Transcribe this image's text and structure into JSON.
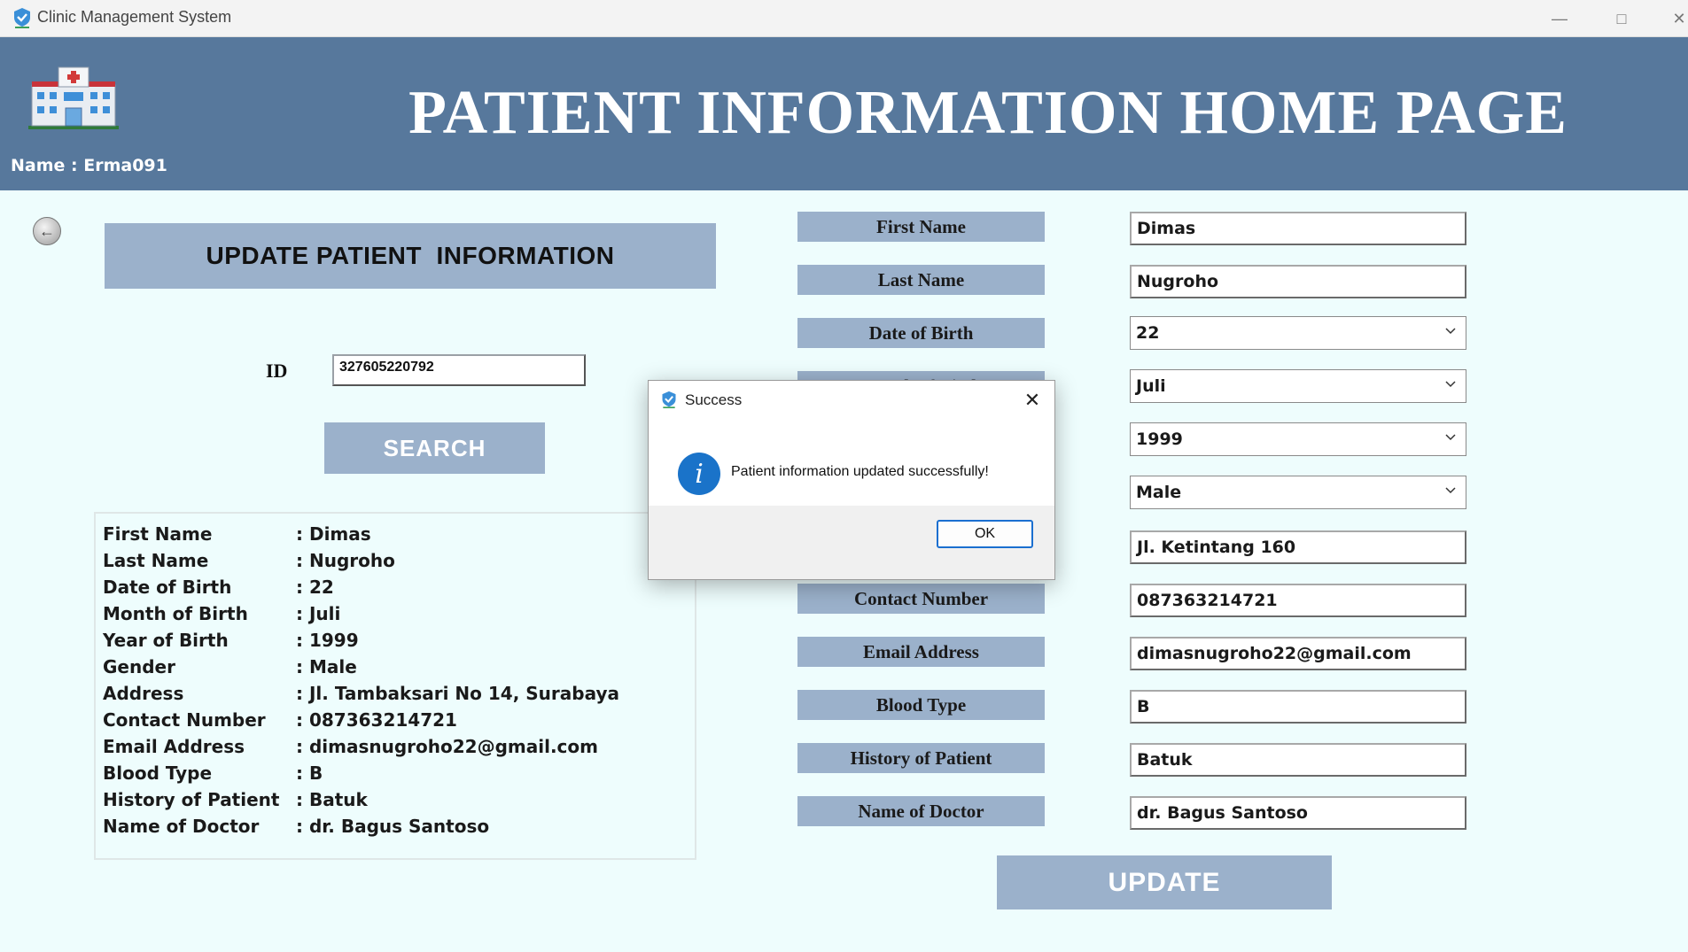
{
  "window": {
    "title": "Clinic Management System"
  },
  "header": {
    "heading": "PATIENT INFORMATION HOME PAGE",
    "user": "Name :  Erma091"
  },
  "left_panel": {
    "banner": "UPDATE PATIENT  INFORMATION",
    "id_label": "ID",
    "id_value": "327605220792",
    "search_label": "SEARCH",
    "info": [
      {
        "key": "First Name",
        "value": ": Dimas"
      },
      {
        "key": "Last Name",
        "value": ": Nugroho"
      },
      {
        "key": "Date of Birth",
        "value": ": 22"
      },
      {
        "key": "Month of Birth",
        "value": ": Juli"
      },
      {
        "key": "Year of Birth",
        "value": ": 1999"
      },
      {
        "key": "Gender",
        "value": ": Male"
      },
      {
        "key": "Address",
        "value": ": Jl. Tambaksari No 14, Surabaya"
      },
      {
        "key": "Contact Number",
        "value": ": 087363214721"
      },
      {
        "key": "Email Address",
        "value": ": dimasnugroho22@gmail.com"
      },
      {
        "key": "Blood Type",
        "value": ": B"
      },
      {
        "key": "History of Patient",
        "value": ": Batuk"
      },
      {
        "key": "Name of Doctor",
        "value": ": dr. Bagus Santoso"
      }
    ]
  },
  "form": {
    "labels": {
      "first_name": "First Name",
      "last_name": "Last Name",
      "date_of_birth": "Date of Birth",
      "month_of_birth": "Month of Birth",
      "contact_number": "Contact Number",
      "email_address": "Email Address",
      "blood_type": "Blood Type",
      "history": "History of Patient",
      "doctor": "Name of Doctor"
    },
    "values": {
      "first_name": "Dimas",
      "last_name": "Nugroho",
      "day": "22",
      "month": "Juli",
      "year": "1999",
      "gender": "Male",
      "address": "Jl. Ketintang 160",
      "contact_number": "087363214721",
      "email_address": "dimasnugroho22@gmail.com",
      "blood_type": "B",
      "history": "Batuk",
      "doctor": "dr. Bagus Santoso"
    },
    "update_label": "UPDATE"
  },
  "dialog": {
    "title": "Success",
    "message": "Patient information updated successfully!",
    "ok_label": "OK"
  },
  "colors": {
    "header": "#57789c",
    "panel": "#9bb1cb",
    "background": "#eefdfd",
    "info_icon": "#1a73c9"
  }
}
